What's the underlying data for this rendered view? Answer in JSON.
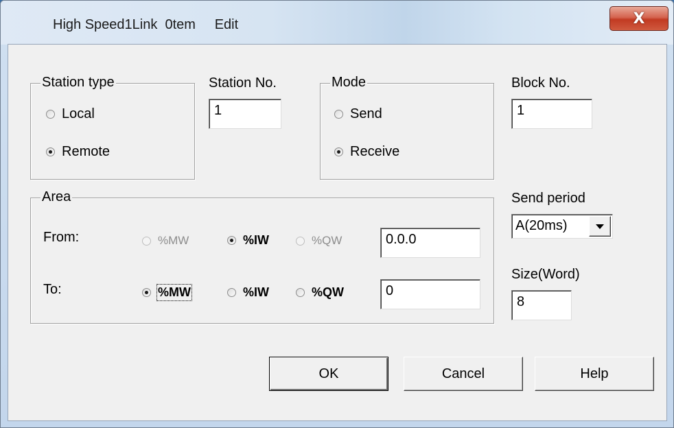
{
  "window": {
    "title": "High Speed1Link  0tem     Edit",
    "close_glyph": "X"
  },
  "station_type": {
    "legend": "Station type",
    "options": [
      {
        "label": "Local",
        "checked": false
      },
      {
        "label": "Remote",
        "checked": true
      }
    ]
  },
  "station_no": {
    "label": "Station No.",
    "value": "1"
  },
  "mode": {
    "legend": "Mode",
    "options": [
      {
        "label": "Send",
        "checked": false
      },
      {
        "label": "Receive",
        "checked": true
      }
    ]
  },
  "block_no": {
    "label": "Block No.",
    "value": "1"
  },
  "area": {
    "legend": "Area",
    "from": {
      "label": "From:",
      "options": [
        {
          "label": "%MW",
          "checked": false,
          "enabled": false
        },
        {
          "label": "%IW",
          "checked": true,
          "enabled": true
        },
        {
          "label": "%QW",
          "checked": false,
          "enabled": false
        }
      ],
      "value": "0.0.0"
    },
    "to": {
      "label": "To:",
      "options": [
        {
          "label": "%MW",
          "checked": true,
          "enabled": true
        },
        {
          "label": "%IW",
          "checked": false,
          "enabled": true
        },
        {
          "label": "%QW",
          "checked": false,
          "enabled": true
        }
      ],
      "value": "0"
    }
  },
  "send_period": {
    "label": "Send period",
    "value": "A(20ms)"
  },
  "size_word": {
    "label": "Size(Word)",
    "value": "8"
  },
  "buttons": {
    "ok": "OK",
    "cancel": "Cancel",
    "help": "Help"
  },
  "icons": {
    "radio": "radio-button",
    "dropdown": "dropdown-arrow-icon",
    "close": "close-icon"
  },
  "colors": {
    "close_button": "#c23a22",
    "disabled_text": "#8d8d8d",
    "dialog_bg": "#f0f0f0"
  }
}
